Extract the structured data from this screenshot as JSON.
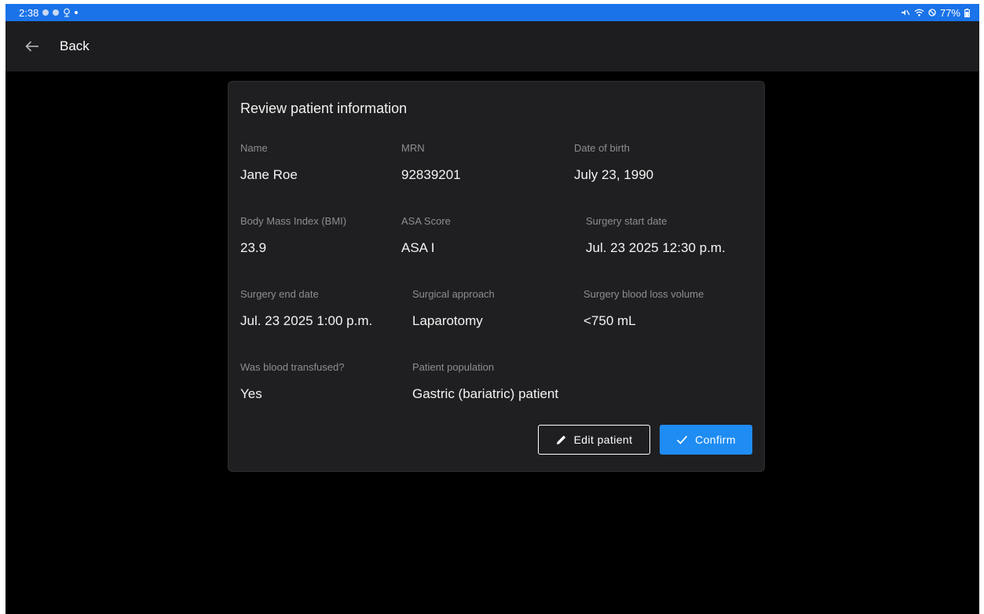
{
  "status_bar": {
    "time": "2:38",
    "battery": "77%"
  },
  "app_bar": {
    "back_label": "Back"
  },
  "card": {
    "title": "Review patient information",
    "fields": [
      {
        "label": "Name",
        "value": "Jane Roe"
      },
      {
        "label": "MRN",
        "value": "92839201"
      },
      {
        "label": "Date of birth",
        "value": "July 23, 1990"
      },
      {
        "label": "Body Mass Index (BMI)",
        "value": "23.9"
      },
      {
        "label": "ASA Score",
        "value": "ASA I"
      },
      {
        "label": "Surgery start date",
        "value": "Jul. 23 2025 12:30 p.m."
      },
      {
        "label": "Surgery end date",
        "value": "Jul. 23 2025 1:00 p.m."
      },
      {
        "label": "Surgical approach",
        "value": "Laparotomy"
      },
      {
        "label": "Surgery blood loss volume",
        "value": "<750 mL"
      },
      {
        "label": "Was blood transfused?",
        "value": "Yes"
      },
      {
        "label": "Patient population",
        "value": "Gastric (bariatric) patient"
      }
    ],
    "actions": {
      "edit_label": "Edit patient",
      "confirm_label": "Confirm"
    }
  },
  "colors": {
    "status_bar": "#1a73e8",
    "accent": "#1f8cf3",
    "card_background": "#1f1f21"
  }
}
